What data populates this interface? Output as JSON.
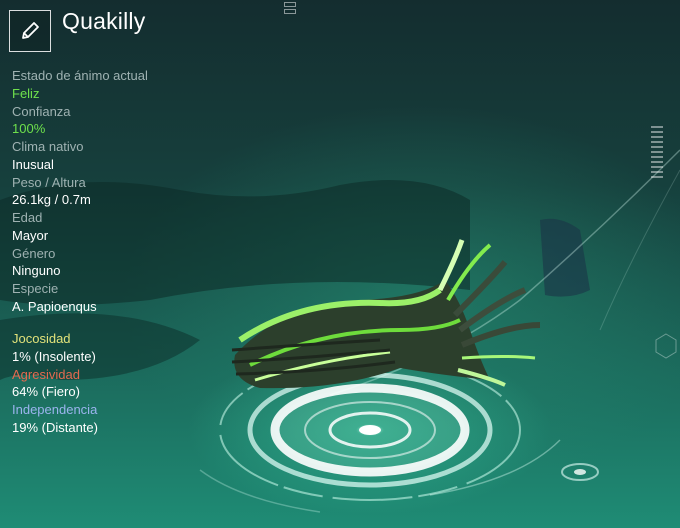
{
  "creature": {
    "name": "Quakilly"
  },
  "stats": [
    {
      "label": "Estado de ánimo actual",
      "value": "Feliz",
      "highlight": true
    },
    {
      "label": "Confianza",
      "value": "100%",
      "highlight": true
    },
    {
      "label": "Clima nativo",
      "value": "Inusual",
      "highlight": false
    },
    {
      "label": "Peso / Altura",
      "value": "26.1kg / 0.7m",
      "highlight": false
    },
    {
      "label": "Edad",
      "value": "Mayor",
      "highlight": false
    },
    {
      "label": "Género",
      "value": "Ninguno",
      "highlight": false
    },
    {
      "label": "Especie",
      "value": "A. Papioenqus",
      "highlight": false
    }
  ],
  "traits": [
    {
      "label": "Jocosidad",
      "value": "1% (Insolente)",
      "color": "#e2e27a"
    },
    {
      "label": "Agresividad",
      "value": "64% (Fiero)",
      "color": "#e36a4f"
    },
    {
      "label": "Independencia",
      "value": "19% (Distante)",
      "color": "#9bb4ee"
    }
  ],
  "icons": {
    "edit": "pencil-icon"
  }
}
